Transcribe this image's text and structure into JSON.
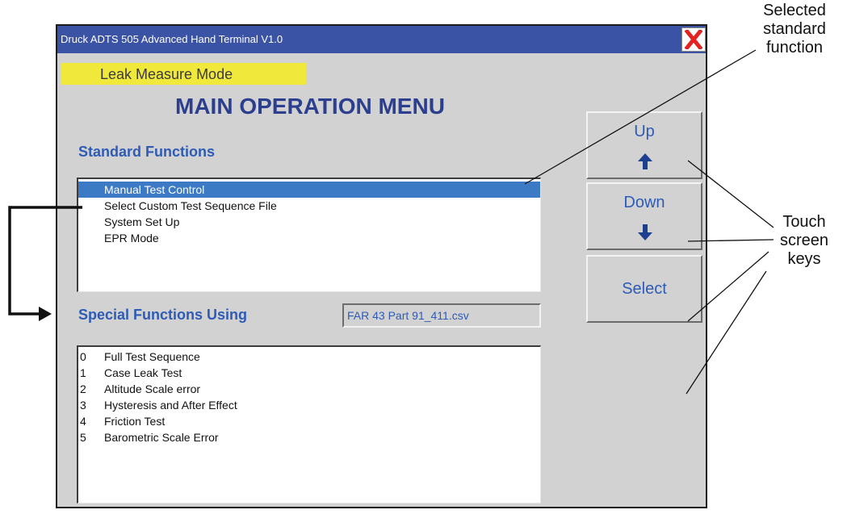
{
  "window": {
    "title": "Druck ADTS 505 Advanced Hand Terminal V1.0",
    "close_glyph": "X"
  },
  "mode_banner": "Leak Measure Mode",
  "menu_title": "MAIN OPERATION MENU",
  "standard_functions": {
    "label": "Standard Functions",
    "items": [
      {
        "label": "Manual Test Control",
        "selected": true
      },
      {
        "label": "Select Custom Test Sequence File",
        "selected": false
      },
      {
        "label": "System Set Up",
        "selected": false
      },
      {
        "label": "EPR Mode",
        "selected": false
      }
    ]
  },
  "special_functions": {
    "label": "Special Functions Using",
    "file": "FAR 43 Part 91_411.csv",
    "items": [
      {
        "num": "0",
        "label": "Full Test Sequence"
      },
      {
        "num": "1",
        "label": "Case Leak Test"
      },
      {
        "num": "2",
        "label": "Altitude Scale error"
      },
      {
        "num": "3",
        "label": "Hysteresis and After Effect"
      },
      {
        "num": "4",
        "label": "Friction Test"
      },
      {
        "num": "5",
        "label": "Barometric Scale Error"
      }
    ]
  },
  "keys": {
    "up": "Up",
    "down": "Down",
    "select": "Select"
  },
  "annotations": {
    "selected_line1": "Selected",
    "selected_line2": "standard",
    "selected_line3": "function",
    "touch_line1": "Touch",
    "touch_line2": "screen",
    "touch_line3": "keys"
  },
  "colors": {
    "titlebar": "#3b53a4",
    "window_bg": "#d2d2d2",
    "banner": "#f0e83a",
    "accent_blue": "#2d5bb6",
    "selection": "#3d7ac6",
    "close_x": "#e32222"
  }
}
